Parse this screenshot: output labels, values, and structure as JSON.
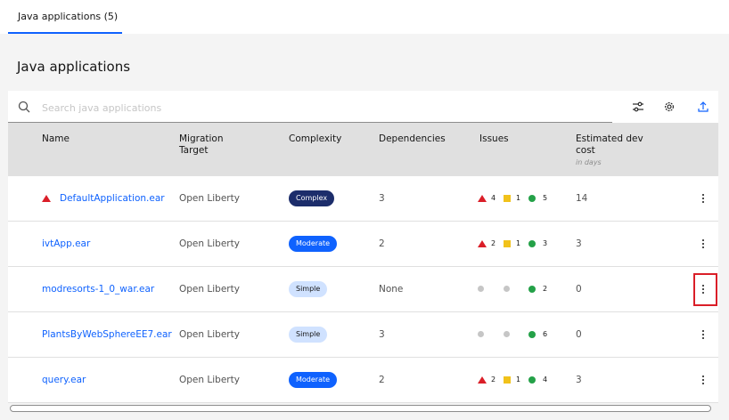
{
  "tab": {
    "label": "Java applications (5)"
  },
  "page_title": "Java applications",
  "search": {
    "placeholder": "Search java applications",
    "value": ""
  },
  "toolbar_icons": [
    "filter-settings-icon",
    "gear-icon",
    "export-upload-icon"
  ],
  "table": {
    "columns": [
      {
        "label": "Name"
      },
      {
        "label": "Migration Target"
      },
      {
        "label": "Complexity"
      },
      {
        "label": "Dependencies"
      },
      {
        "label": "Issues"
      },
      {
        "label": "Estimated dev cost",
        "sub": "in days"
      }
    ],
    "rows": [
      {
        "name": "DefaultApplication.ear",
        "warning": true,
        "target": "Open Liberty",
        "complexity": "Complex",
        "dependencies": "3",
        "issues": {
          "critical": "4",
          "warning": "1",
          "info": "5"
        },
        "cost": "14"
      },
      {
        "name": "ivtApp.ear",
        "warning": false,
        "target": "Open Liberty",
        "complexity": "Moderate",
        "dependencies": "2",
        "issues": {
          "critical": "2",
          "warning": "1",
          "info": "3"
        },
        "cost": "3"
      },
      {
        "name": "modresorts-1_0_war.ear",
        "warning": false,
        "target": "Open Liberty",
        "complexity": "Simple",
        "dependencies": "None",
        "issues": {
          "critical": "",
          "warning": "",
          "info": "2"
        },
        "cost": "0"
      },
      {
        "name": "PlantsByWebSphereEE7.ear",
        "warning": false,
        "target": "Open Liberty",
        "complexity": "Simple",
        "dependencies": "3",
        "issues": {
          "critical": "",
          "warning": "",
          "info": "6"
        },
        "cost": "0"
      },
      {
        "name": "query.ear",
        "warning": false,
        "target": "Open Liberty",
        "complexity": "Moderate",
        "dependencies": "2",
        "issues": {
          "critical": "2",
          "warning": "1",
          "info": "4"
        },
        "cost": "3"
      }
    ]
  },
  "colors": {
    "accent": "#0f62fe",
    "critical": "#da1e28",
    "warning": "#f1c21b",
    "info": "#24a148",
    "complex": "#1c2d6b",
    "simple": "#d0e2ff"
  }
}
